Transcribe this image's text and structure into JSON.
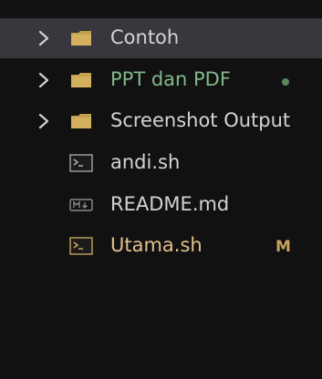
{
  "tree": {
    "items": [
      {
        "label": "Contoh",
        "kind": "folder",
        "selected": true
      },
      {
        "label": "PPT dan PDF",
        "kind": "folder",
        "color": "#81b88b",
        "status_dot": true
      },
      {
        "label": "Screenshot Output",
        "kind": "folder"
      },
      {
        "label": "andi.sh",
        "kind": "file",
        "icon": "terminal-file-icon"
      },
      {
        "label": "README.md",
        "kind": "file",
        "icon": "markdown-file-icon"
      },
      {
        "label": "Utama.sh",
        "kind": "file",
        "icon": "terminal-file-icon",
        "color": "#e2c08d",
        "badge": "M"
      }
    ]
  },
  "colors": {
    "background": "#111111",
    "selection": "#37373d",
    "text": "#d4d4d4",
    "untracked": "#81b88b",
    "modified": "#e2c08d",
    "folder": "#c5a04f"
  }
}
